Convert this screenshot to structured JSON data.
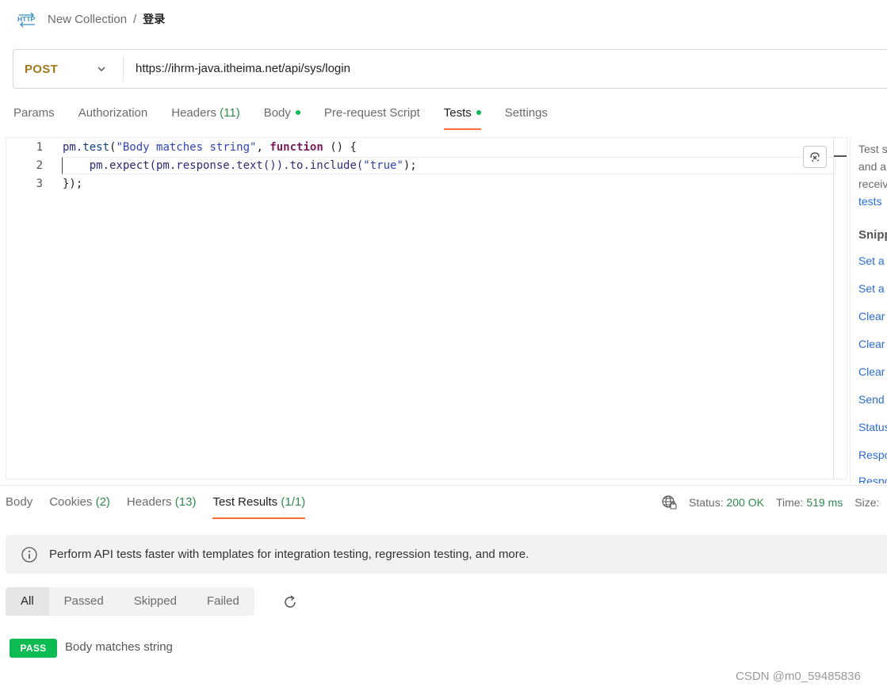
{
  "breadcrumb": {
    "icon": "http-icon",
    "collection": "New Collection",
    "separator": "/",
    "request": "登录"
  },
  "request": {
    "method": "POST",
    "url": "https://ihrm-java.itheima.net/api/sys/login"
  },
  "request_tabs": [
    {
      "label": "Params",
      "count": "",
      "dot": false,
      "active": false
    },
    {
      "label": "Authorization",
      "count": "",
      "dot": false,
      "active": false
    },
    {
      "label": "Headers",
      "count": "(11)",
      "dot": false,
      "active": false
    },
    {
      "label": "Body",
      "count": "",
      "dot": true,
      "active": false
    },
    {
      "label": "Pre-request Script",
      "count": "",
      "dot": false,
      "active": false
    },
    {
      "label": "Tests",
      "count": "",
      "dot": true,
      "active": true
    },
    {
      "label": "Settings",
      "count": "",
      "dot": false,
      "active": false
    }
  ],
  "editor": {
    "line_numbers": [
      "1",
      "2",
      "3"
    ]
  },
  "snippets_panel": {
    "desc": [
      "Test s",
      "and a",
      "receiv"
    ],
    "tests_link": "tests",
    "heading": "Snipp",
    "items": [
      "Set a",
      "Set a",
      "Clear",
      "Clear",
      "Clear",
      "Send",
      "Status",
      "Respo",
      "Respo"
    ]
  },
  "response_tabs": [
    {
      "label": "Body",
      "count": "",
      "active": false
    },
    {
      "label": "Cookies",
      "count": "(2)",
      "active": false
    },
    {
      "label": "Headers",
      "count": "(13)",
      "active": false
    },
    {
      "label": "Test Results",
      "count": "(1/1)",
      "active": true
    }
  ],
  "status": {
    "status_label": "Status:",
    "status_value": "200 OK",
    "time_label": "Time:",
    "time_value": "519 ms",
    "size_label": "Size:"
  },
  "banner": {
    "text": "Perform API tests faster with templates for integration testing, regression testing, and more."
  },
  "filters": [
    {
      "label": "All",
      "active": true
    },
    {
      "label": "Passed",
      "active": false
    },
    {
      "label": "Skipped",
      "active": false
    },
    {
      "label": "Failed",
      "active": false
    }
  ],
  "results": [
    {
      "badge": "PASS",
      "name": "Body matches string"
    }
  ],
  "watermark": "CSDN @m0_59485836",
  "colors": {
    "accent": "#ff6c37",
    "pass": "#0cbb52",
    "method": "#a0781b",
    "link": "#2b6bd6"
  }
}
